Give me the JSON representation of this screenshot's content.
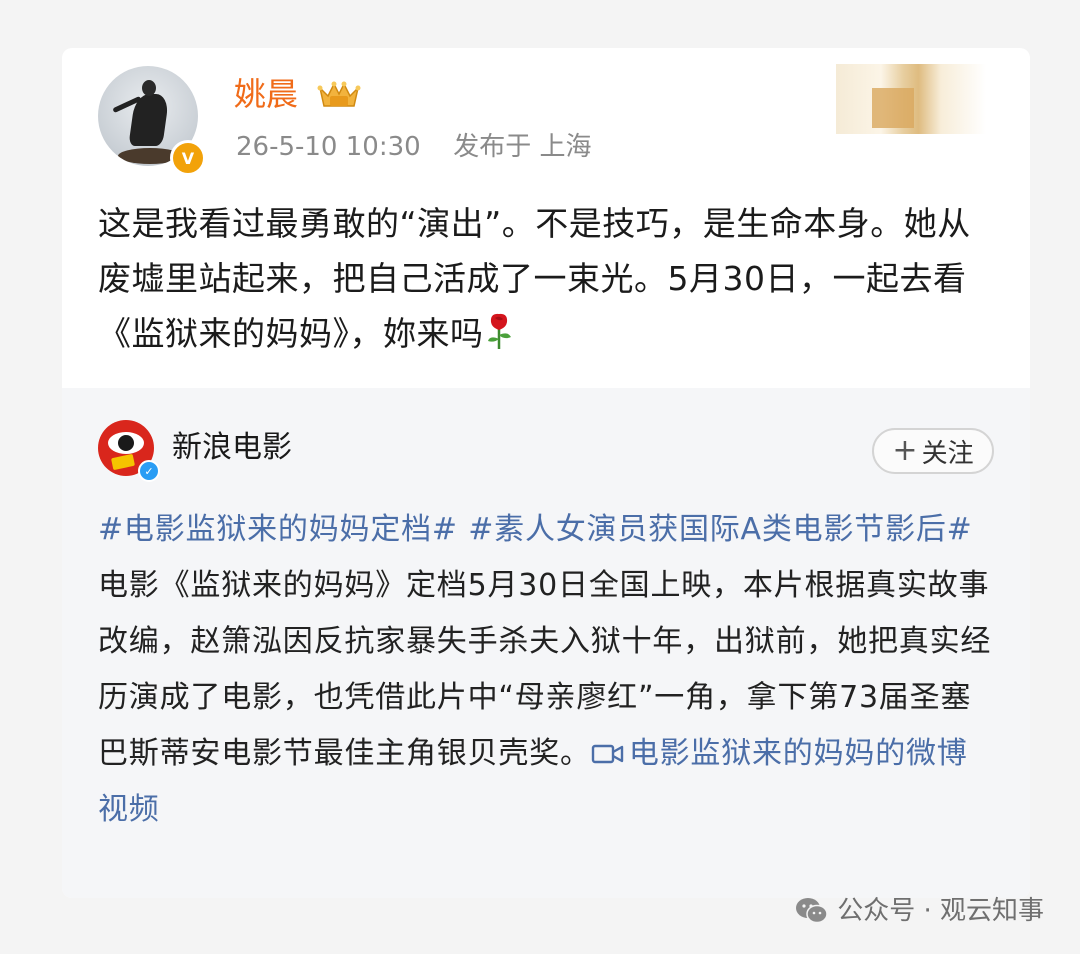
{
  "post": {
    "author": "姚晨",
    "timestamp": "26-5-10 10:30",
    "location": "发布于 上海",
    "text": "这是我看过最勇敢的“演出”。不是技巧，是生命本身。她从废墟里站起来，把自己活成了一束光。5月30日，一起去看《监狱来的妈妈》，妳来吗",
    "icons": {
      "verify": "verified-badge-icon",
      "membership": "crown-icon",
      "emoji": "rose-icon"
    }
  },
  "repost": {
    "author": "新浪电影",
    "follow_label": "关注",
    "follow_symbol": "+",
    "hashtag_1": "#电影监狱来的妈妈定档#",
    "hashtag_2": "#素人女演员获国际A类电影节影后#",
    "body": " 电影《监狱来的妈妈》定档5月30日全国上映，本片根据真实故事改编，赵箫泓因反抗家暴失手杀夫入狱十年，出狱前，她把真实经历演成了电影，也凭借此片中“母亲廖红”一角，拿下第73届圣塞巴斯蒂安电影节最佳主角银贝壳奖。",
    "video_link": "电影监狱来的妈妈的微博视频",
    "link_color": "#4b6ea8"
  },
  "watermark": {
    "text": "公众号 · 观云知事",
    "icon": "wechat-icon"
  },
  "colors": {
    "author_name": "#f06b19",
    "verify_orange": "#f2a20a",
    "verify_blue": "#2a9df4"
  }
}
